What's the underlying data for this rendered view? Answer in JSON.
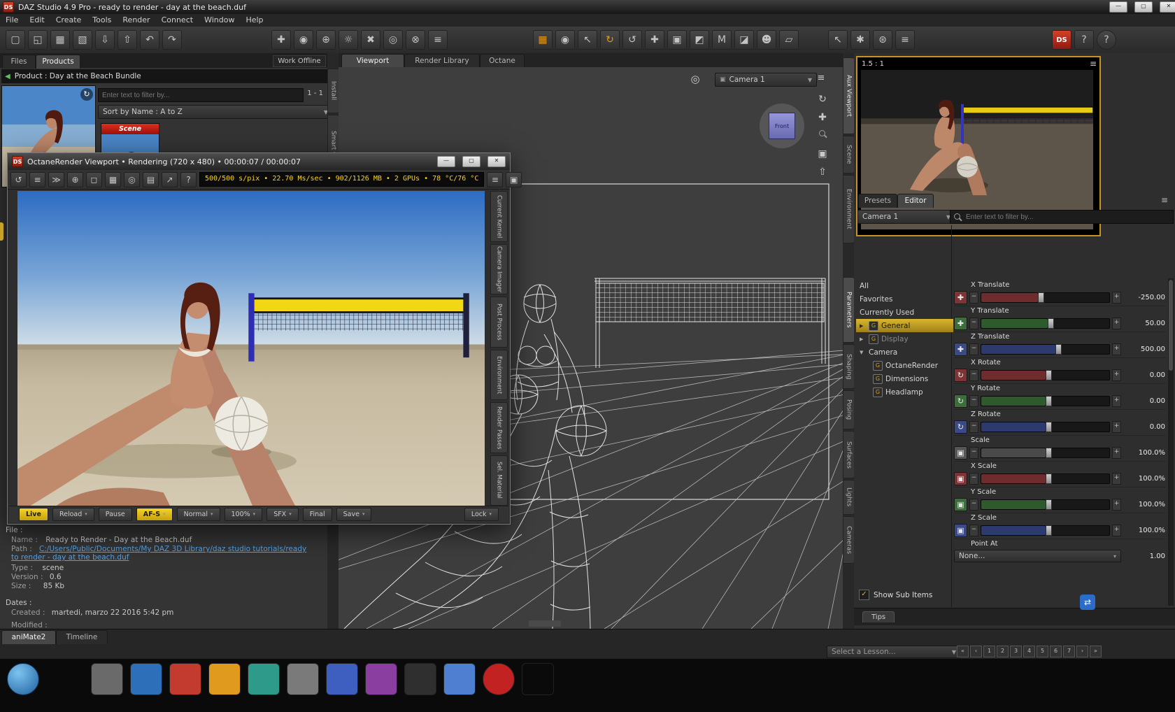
{
  "titlebar": {
    "logo": "DS",
    "title": "DAZ Studio 4.9 Pro - ready to render - day at the beach.duf"
  },
  "window_controls": {
    "minimize": "—",
    "maximize": "▢",
    "close": "✕"
  },
  "glyphs": {
    "caret": "▼",
    "caret_sm": "▾",
    "menu": "≡",
    "expander": "▶",
    "expander_open": "▼",
    "minus": "−",
    "plus": "+",
    "check": "✓",
    "back": "◀",
    "refresh": "↻",
    "translate": "✚",
    "rotate": "↻",
    "scale": "▣",
    "gear": "▤",
    "orbit": "↻",
    "pan": "✚",
    "frame": "▣",
    "home": "⇧",
    "sphere": "◎",
    "snapshot": "▣",
    "group": "G"
  },
  "menu": {
    "items": [
      "File",
      "Edit",
      "Create",
      "Tools",
      "Render",
      "Connect",
      "Window",
      "Help"
    ]
  },
  "toolbar": {
    "icons": [
      "▢",
      "◱",
      "▦",
      "▧",
      "⇩",
      "⇧",
      "↶",
      "↷",
      "✚",
      "◉",
      "⊕",
      "☼",
      "✖",
      "◎",
      "⊗",
      "≡",
      "▦",
      "◉",
      "↖",
      "↻",
      "↺",
      "✚",
      "▣",
      "◩",
      "M",
      "◪",
      "☻",
      "▱",
      "↖",
      "✱",
      "⊛",
      "≡"
    ],
    "ds_logo": "DS",
    "whats_this": "?",
    "help": "?"
  },
  "left_panel": {
    "tab_files": "Files",
    "tab_products": "Products",
    "work_offline": "Work Offline",
    "product_header": "Product : Day at the Beach Bundle",
    "filter_placeholder": "Enter text to filter by...",
    "result_count": "1 - 1",
    "sort_label": "Sort by Name : A to Z",
    "item_badge": "Scene",
    "side_tabs": [
      "Install",
      "Smart Content"
    ]
  },
  "octane": {
    "title": "OctaneRender Viewport • Rendering (720 x 480) • 00:00:07 / 00:00:07",
    "stats": "500/500 s/pix • 22.70 Ms/sec • 902/1126 MB • 2 GPUs • 78 °C/76 °C",
    "tool_icons": [
      "↺",
      "≡",
      "≫",
      "⊕",
      "◻",
      "▦",
      "◎",
      "▤",
      "↗",
      "?"
    ],
    "side_tabs": [
      "Current Kernel",
      "Camera Imager",
      "Post Process",
      "Environment",
      "Render Passes",
      "Sel. Material"
    ],
    "btn_live": "Live",
    "btn_reload": "Reload",
    "btn_pause": "Pause",
    "btn_afs": "AF-S",
    "btn_normal": "Normal",
    "btn_zoom": "100%",
    "btn_sfx": "SFX",
    "btn_final": "Final",
    "btn_save": "Save",
    "btn_lock": "Lock"
  },
  "viewport": {
    "tabs": [
      "Viewport",
      "Render Library",
      "Octane"
    ],
    "camera": "Camera 1",
    "cube_face": "Front"
  },
  "dock_tabs": [
    "Aux Viewport",
    "Scene",
    "Environment",
    "Parameters",
    "Shaping",
    "Posing",
    "Surfaces",
    "Lights",
    "Cameras"
  ],
  "aux_viewport": {
    "ratio": "1.5 : 1"
  },
  "params": {
    "tab_presets": "Presets",
    "tab_editor": "Editor",
    "camera": "Camera 1",
    "filter_placeholder": "Enter text to filter by...",
    "groups": [
      "All",
      "Favorites",
      "Currently Used",
      "General",
      "Display",
      "Camera",
      "OctaneRender",
      "Dimensions",
      "Headlamp"
    ],
    "sliders": [
      {
        "name": "X Translate",
        "value": "-250.00"
      },
      {
        "name": "Y Translate",
        "value": "50.00"
      },
      {
        "name": "Z Translate",
        "value": "500.00"
      },
      {
        "name": "X Rotate",
        "value": "0.00"
      },
      {
        "name": "Y Rotate",
        "value": "0.00"
      },
      {
        "name": "Z Rotate",
        "value": "0.00"
      },
      {
        "name": "Scale",
        "value": "100.0%"
      },
      {
        "name": "X Scale",
        "value": "100.0%"
      },
      {
        "name": "Y Scale",
        "value": "100.0%"
      },
      {
        "name": "Z Scale",
        "value": "100.0%"
      }
    ],
    "point_at_label": "Point At",
    "point_at_value": "None...",
    "point_at_weight": "1.00",
    "show_sub_items": "Show Sub Items",
    "tips": "Tips"
  },
  "file_info": {
    "file_header": "File :",
    "name_label": "Name :",
    "name": "Ready to Render - Day at the Beach.duf",
    "path_label": "Path :",
    "path": "C:/Users/Public/Documents/My DAZ 3D Library/daz studio tutorials/ready to render - day at the beach.duf",
    "type_label": "Type :",
    "type": "scene",
    "version_label": "Version :",
    "version": "0.6",
    "size_label": "Size :",
    "size": "85 Kb",
    "dates_header": "Dates :",
    "created_label": "Created :",
    "created": "martedi, marzo 22 2016 5:42 pm",
    "modified_label": "Modified :"
  },
  "bottom": {
    "tab_animate": "aniMate2",
    "tab_timeline": "Timeline",
    "lesson_placeholder": "Select a Lesson...",
    "lesson_nav": [
      "«",
      "‹",
      "1",
      "2",
      "3",
      "4",
      "5",
      "6",
      "7",
      "›",
      "»"
    ]
  },
  "colors": {
    "accent_yellow": "#c9a227",
    "axis_x": "#7e3434",
    "axis_y": "#3c6e3c",
    "axis_z": "#3a4a86",
    "link_blue": "#5aa0e0",
    "octane_stats_yellow": "#ffd400",
    "scene_badge_red": "#cc1a1a",
    "aux_border_gold": "#c79422"
  }
}
